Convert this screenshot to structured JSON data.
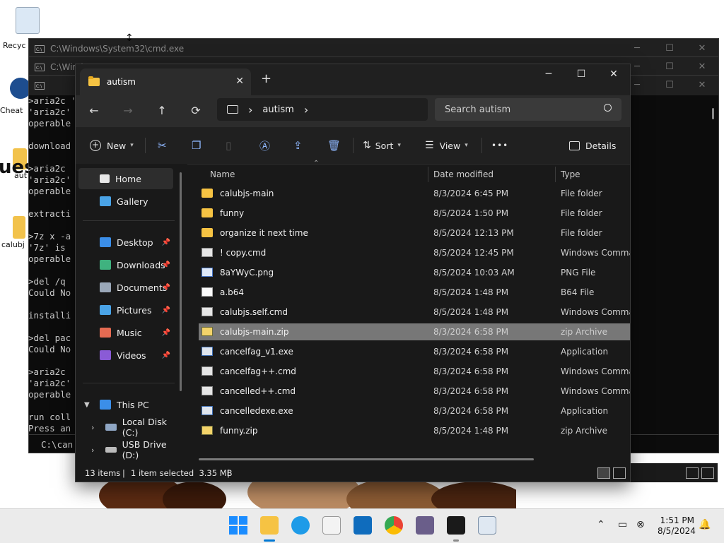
{
  "desktop": {
    "icons": [
      {
        "label": "Recyc"
      },
      {
        "label": "Cheat"
      },
      {
        "label": "aut"
      },
      {
        "label": "calubj"
      }
    ],
    "partial_text": "ues"
  },
  "cmd_windows": [
    {
      "title": "C:\\Windows\\System32\\cmd.exe"
    },
    {
      "title": "C:\\Windo"
    },
    {
      "title": ""
    }
  ],
  "cmd_output": {
    "lines": [
      ">aria2c '",
      "'aria2c'",
      "operable",
      "",
      "download",
      "",
      ">aria2c ",
      "'aria2c'",
      "operable",
      "",
      "extracti",
      "",
      ">7z x -a",
      "'7z' is ",
      "operable",
      "",
      ">del /q ",
      "Could No",
      "",
      "installi",
      "",
      ">del pac",
      "Could No",
      "",
      ">aria2c ",
      "'aria2c'",
      "operable",
      "",
      "run coll",
      "Press an"
    ],
    "prompt": "C:\\can"
  },
  "explorer": {
    "tab_title": "autism",
    "new_tab": "+",
    "window_controls": {
      "minimize": "─",
      "maximize": "☐",
      "close": "✕"
    },
    "nav": {
      "back": "←",
      "forward": "→",
      "up": "↑",
      "refresh": "⟳"
    },
    "address": {
      "crumb": "autism",
      "sep": "›"
    },
    "search_placeholder": "Search autism",
    "commands": {
      "new": "New",
      "sort": "Sort",
      "view": "View",
      "more": "•••",
      "details": "Details"
    },
    "sidebar": {
      "home": "Home",
      "gallery": "Gallery",
      "quick": [
        {
          "label": "Desktop",
          "color": "#3b8ee8"
        },
        {
          "label": "Downloads",
          "color": "#3fb27f"
        },
        {
          "label": "Documents",
          "color": "#9aa7b8"
        },
        {
          "label": "Pictures",
          "color": "#4aa3e6"
        },
        {
          "label": "Music",
          "color": "#e56b52"
        },
        {
          "label": "Videos",
          "color": "#8a5bd6"
        }
      ],
      "this_pc": "This PC",
      "local_disk": "Local Disk (C:)",
      "usb": "USB Drive (D:)"
    },
    "columns": {
      "name": "Name",
      "date": "Date modified",
      "type": "Type"
    },
    "files": [
      {
        "name": "calubjs-main",
        "date": "8/3/2024 6:45 PM",
        "type": "File folder",
        "kind": "folder"
      },
      {
        "name": "funny",
        "date": "8/5/2024 1:50 PM",
        "type": "File folder",
        "kind": "folder"
      },
      {
        "name": "organize it next time",
        "date": "8/5/2024 12:13 PM",
        "type": "File folder",
        "kind": "folder"
      },
      {
        "name": "! copy.cmd",
        "date": "8/5/2024 12:45 PM",
        "type": "Windows Comman",
        "kind": "cmd"
      },
      {
        "name": "8aYWyC.png",
        "date": "8/5/2024 10:03 AM",
        "type": "PNG File",
        "kind": "png"
      },
      {
        "name": "a.b64",
        "date": "8/5/2024 1:48 PM",
        "type": "B64 File",
        "kind": "doc"
      },
      {
        "name": "calubjs.self.cmd",
        "date": "8/5/2024 1:48 PM",
        "type": "Windows Comman",
        "kind": "cmd"
      },
      {
        "name": "calubjs-main.zip",
        "date": "8/3/2024 6:58 PM",
        "type": "zip Archive",
        "kind": "zip",
        "selected": true
      },
      {
        "name": "cancelfag_v1.exe",
        "date": "8/3/2024 6:58 PM",
        "type": "Application",
        "kind": "exe"
      },
      {
        "name": "cancelfag++.cmd",
        "date": "8/3/2024 6:58 PM",
        "type": "Windows Comman",
        "kind": "cmd"
      },
      {
        "name": "cancelled++.cmd",
        "date": "8/3/2024 6:58 PM",
        "type": "Windows Comman",
        "kind": "cmd"
      },
      {
        "name": "cancelledexe.exe",
        "date": "8/3/2024 6:58 PM",
        "type": "Application",
        "kind": "exe"
      },
      {
        "name": "funny.zip",
        "date": "8/5/2024 1:48 PM",
        "type": "zip Archive",
        "kind": "zip"
      }
    ],
    "status": {
      "items": "13 items",
      "sep": "|",
      "selected": "1 item selected  3.35 MB"
    }
  },
  "taskbar": {
    "time": "1:51 PM",
    "date": "8/5/2024",
    "apps": [
      "start",
      "file-explorer",
      "edge",
      "store",
      "outlook",
      "chrome",
      "app",
      "terminal",
      "app2"
    ]
  }
}
